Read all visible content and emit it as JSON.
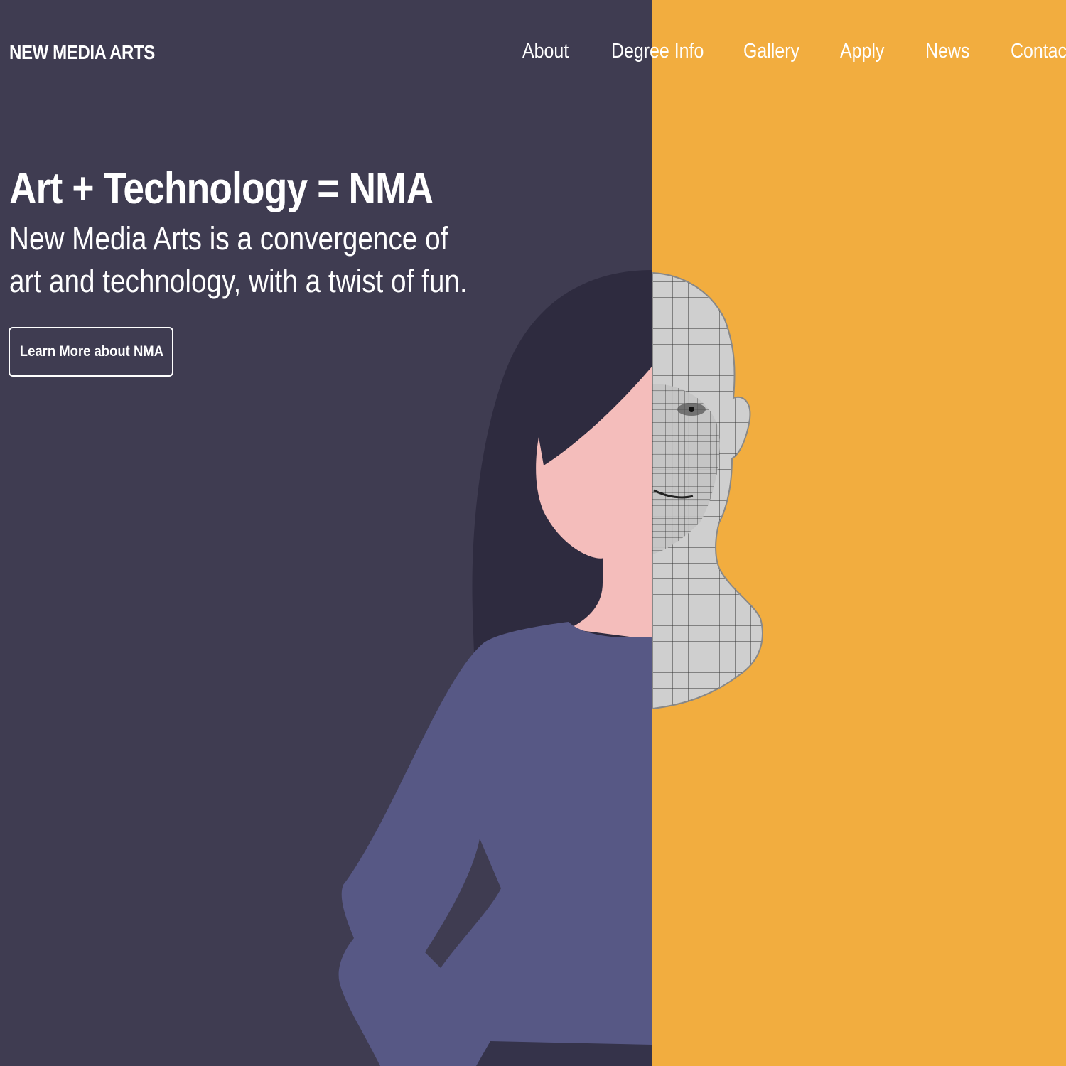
{
  "brand": {
    "name": "NEW MEDIA ARTS"
  },
  "nav": {
    "items": [
      {
        "label": "About"
      },
      {
        "label": "Degree Info"
      },
      {
        "label": "Gallery"
      },
      {
        "label": "Apply"
      },
      {
        "label": "News"
      },
      {
        "label": "Contac"
      }
    ]
  },
  "hero": {
    "headline": "Art + Technology = NMA",
    "tagline": "New Media Arts is a convergence of art and technology, with a twist of fun.",
    "cta_label": "Learn More about NMA"
  },
  "colors": {
    "left_background": "#3f3c51",
    "right_background": "#f2ad3f",
    "hair": "#2e2b3f",
    "skin": "#f4bdbb",
    "sweater": "#575885",
    "wireframe_fill": "#cfcfcf"
  },
  "illustration": {
    "left_half": "illustrated-woman",
    "right_half": "wireframe-3d-head"
  }
}
